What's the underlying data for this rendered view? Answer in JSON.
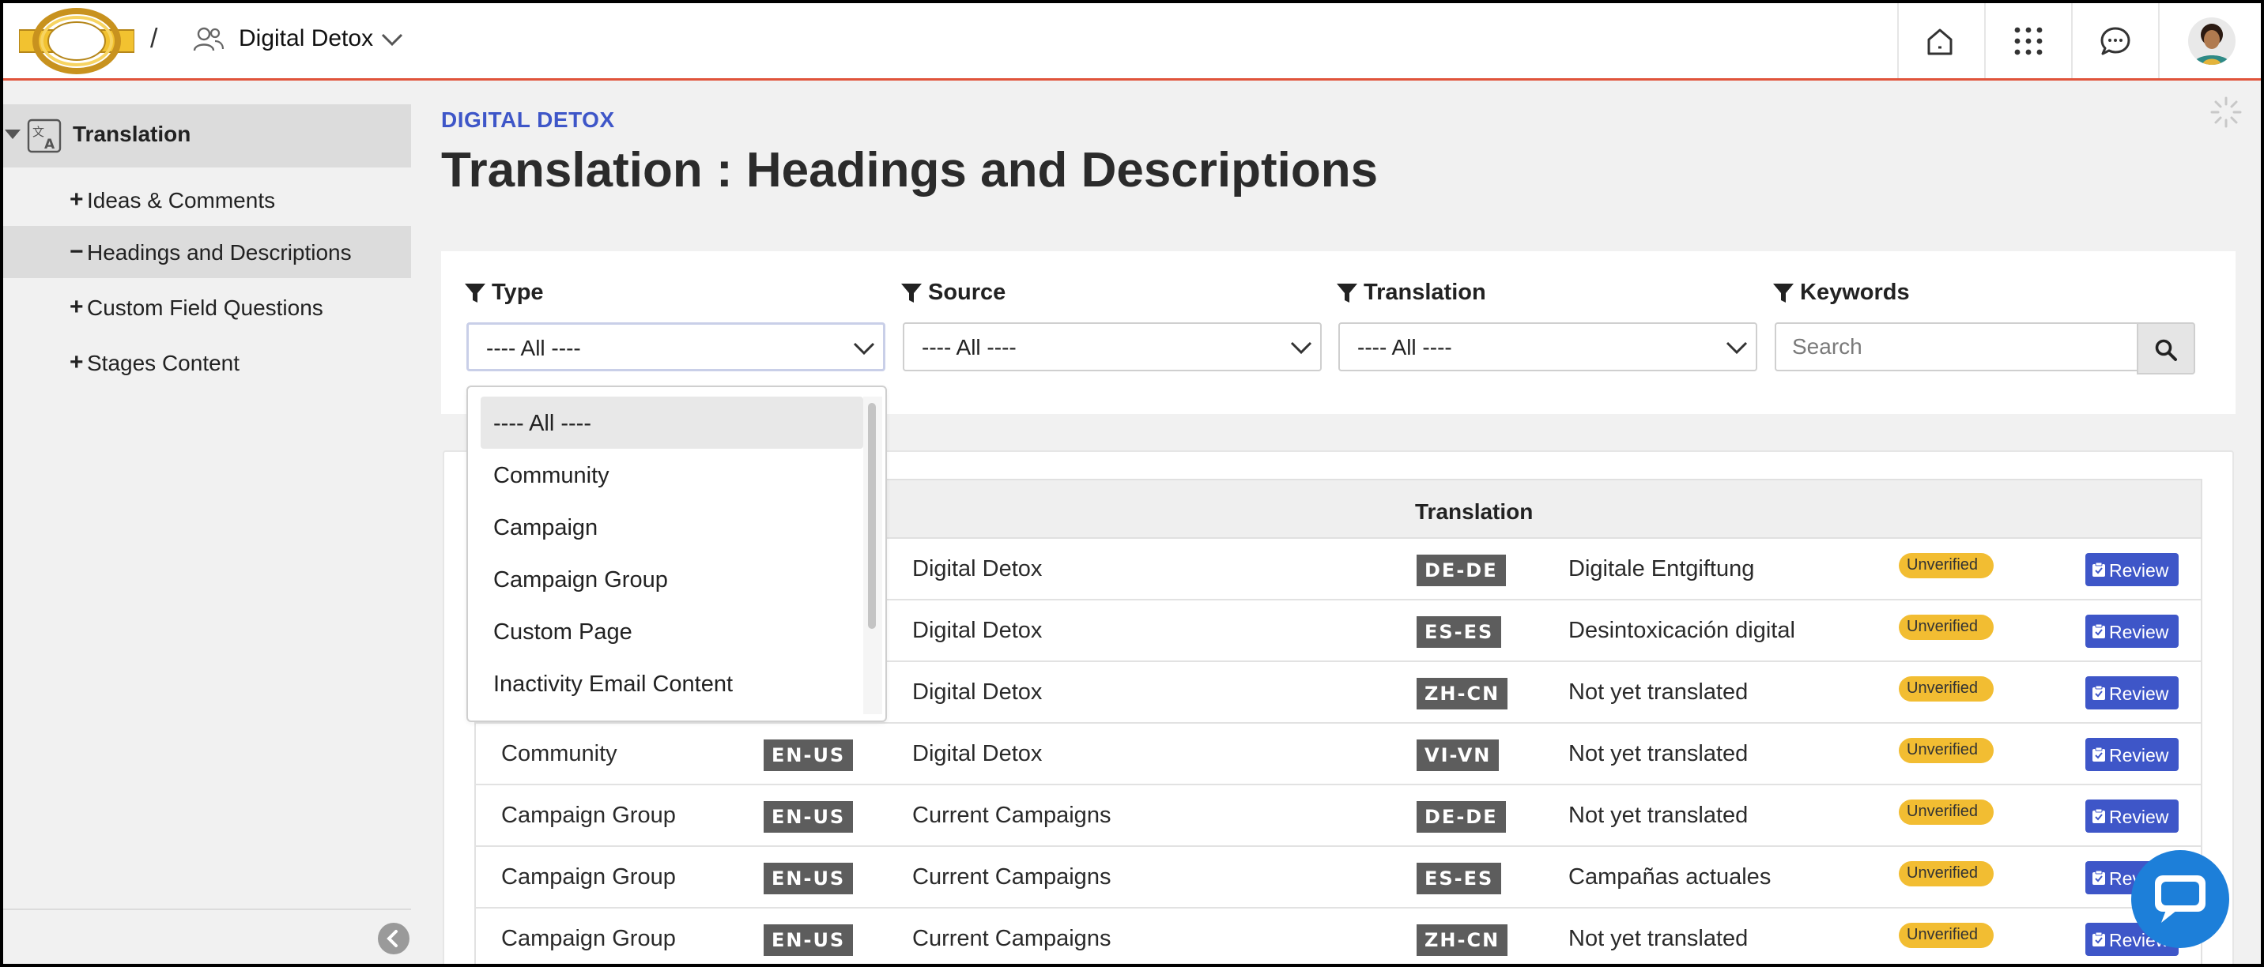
{
  "header": {
    "separator": "/",
    "community_name": "Digital Detox"
  },
  "sidebar": {
    "section_label": "Translation",
    "items": [
      {
        "symbol": "+",
        "label": "Ideas & Comments",
        "active": false
      },
      {
        "symbol": "−",
        "label": "Headings and Descriptions",
        "active": true
      },
      {
        "symbol": "+",
        "label": "Custom Field Questions",
        "active": false
      },
      {
        "symbol": "+",
        "label": "Stages Content",
        "active": false
      }
    ]
  },
  "main": {
    "eyebrow": "DIGITAL DETOX",
    "title": "Translation : Headings and Descriptions"
  },
  "filters": {
    "type": {
      "label": "Type",
      "value": "---- All ----"
    },
    "source": {
      "label": "Source",
      "value": "---- All ----"
    },
    "translation": {
      "label": "Translation",
      "value": "---- All ----"
    },
    "keywords": {
      "label": "Keywords",
      "placeholder": "Search"
    }
  },
  "type_dropdown": {
    "options": [
      "---- All ----",
      "Community",
      "Campaign",
      "Campaign Group",
      "Custom Page",
      "Inactivity Email Content"
    ],
    "selected": "---- All ----"
  },
  "table": {
    "header_translation": "Translation",
    "rows": [
      {
        "type": "",
        "source_lang": "",
        "source_text": "Digital Detox",
        "target_lang": "DE-DE",
        "translation": "Digitale Entgiftung",
        "status": "Unverified",
        "action": "Review"
      },
      {
        "type": "",
        "source_lang": "",
        "source_text": "Digital Detox",
        "target_lang": "ES-ES",
        "translation": "Desintoxicación digital",
        "status": "Unverified",
        "action": "Review"
      },
      {
        "type": "",
        "source_lang": "",
        "source_text": "Digital Detox",
        "target_lang": "ZH-CN",
        "translation": "Not yet translated",
        "status": "Unverified",
        "action": "Review"
      },
      {
        "type": "Community",
        "source_lang": "EN-US",
        "source_text": "Digital Detox",
        "target_lang": "VI-VN",
        "translation": "Not yet translated",
        "status": "Unverified",
        "action": "Review"
      },
      {
        "type": "Campaign Group",
        "source_lang": "EN-US",
        "source_text": "Current Campaigns",
        "target_lang": "DE-DE",
        "translation": "Not yet translated",
        "status": "Unverified",
        "action": "Review"
      },
      {
        "type": "Campaign Group",
        "source_lang": "EN-US",
        "source_text": "Current Campaigns",
        "target_lang": "ES-ES",
        "translation": "Campañas actuales",
        "status": "Unverified",
        "action": "Review"
      },
      {
        "type": "Campaign Group",
        "source_lang": "EN-US",
        "source_text": "Current Campaigns",
        "target_lang": "ZH-CN",
        "translation": "Not yet translated",
        "status": "Unverified",
        "action": "Review"
      }
    ]
  },
  "colors": {
    "accent": "#3e56c8",
    "header_rule": "#e0543b",
    "badge": "#f2bd32",
    "chat": "#1d7fd9"
  },
  "icons": {
    "logo": "gold-ring-logo",
    "community": "people-icon",
    "home": "home-icon",
    "apps": "grid-icon",
    "messages": "chat-bubble-icon",
    "filter": "funnel-icon",
    "search": "search-icon",
    "review": "clipboard-check-icon",
    "collapse": "chevron-left-icon",
    "loading": "spinner-icon"
  }
}
